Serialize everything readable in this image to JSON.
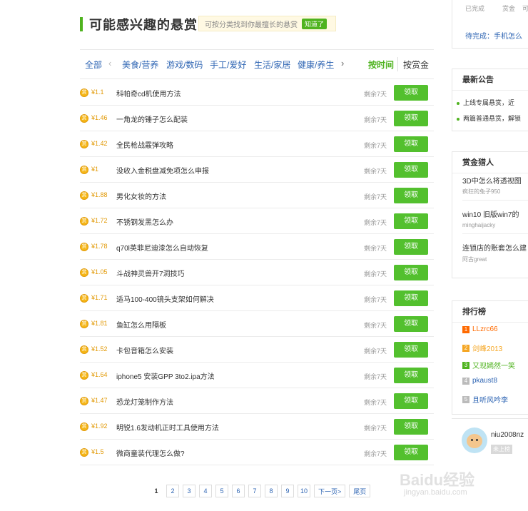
{
  "header": {
    "title": "可能感兴趣的悬赏",
    "tip": "可按分类找到你最擅长的悬赏",
    "tip_button": "知道了"
  },
  "filter": {
    "categories": [
      "全部",
      "美食/营养",
      "游戏/数码",
      "手工/爱好",
      "生活/家居",
      "健康/养生"
    ],
    "prev_arrow": "‹",
    "next_arrow": "›",
    "sort_time": "按时间",
    "sort_reward": "按赏金"
  },
  "questions": [
    {
      "amount": "¥1.1",
      "text": "科帕奇cd机使用方法",
      "remain": "剩余7天",
      "action": "领取"
    },
    {
      "amount": "¥1.46",
      "text": "一角龙的锤子怎么配装",
      "remain": "剩余7天",
      "action": "领取"
    },
    {
      "amount": "¥1.42",
      "text": "全民枪战霰弹攻略",
      "remain": "剩余7天",
      "action": "领取"
    },
    {
      "amount": "¥1",
      "text": "没收入金税盘减免项怎么申报",
      "remain": "剩余7天",
      "action": "领取"
    },
    {
      "amount": "¥1.88",
      "text": "男化女妆的方法",
      "remain": "剩余7天",
      "action": "领取"
    },
    {
      "amount": "¥1.72",
      "text": "不锈钢发黑怎么办",
      "remain": "剩余7天",
      "action": "领取"
    },
    {
      "amount": "¥1.78",
      "text": "q70l英菲尼迪漆怎么自动恢复",
      "remain": "剩余7天",
      "action": "领取"
    },
    {
      "amount": "¥1.05",
      "text": "斗战神灵兽开7洞技巧",
      "remain": "剩余7天",
      "action": "领取"
    },
    {
      "amount": "¥1.71",
      "text": "适马100-400镜头支架如何解决",
      "remain": "剩余7天",
      "action": "领取"
    },
    {
      "amount": "¥1.81",
      "text": "鱼缸怎么用隔板",
      "remain": "剩余7天",
      "action": "领取"
    },
    {
      "amount": "¥1.52",
      "text": "卡包音箱怎么安装",
      "remain": "剩余7天",
      "action": "领取"
    },
    {
      "amount": "¥1.64",
      "text": "iphone5 安装GPP 3to2.ipa方法",
      "remain": "剩余7天",
      "action": "领取"
    },
    {
      "amount": "¥1.47",
      "text": "恐龙灯笼制作方法",
      "remain": "剩余7天",
      "action": "领取"
    },
    {
      "amount": "¥1.92",
      "text": "明锐1.6发动机正时工具使用方法",
      "remain": "剩余7天",
      "action": "领取"
    },
    {
      "amount": "¥1.5",
      "text": "微商童装代理怎么做?",
      "remain": "剩余7天",
      "action": "领取"
    }
  ],
  "coin_glyph": "赏",
  "pager": {
    "current": "1",
    "pages": [
      "2",
      "3",
      "4",
      "5",
      "6",
      "7",
      "8",
      "9",
      "10"
    ],
    "next": "下一页>",
    "last": "尾页"
  },
  "sidebar": {
    "status_tabs": [
      "已完成",
      "赏金",
      "可"
    ],
    "pending": "待完成：手机怎么",
    "notice_title": "最新公告",
    "notices": [
      "上线专属悬赏，近",
      "两篇普通悬赏，解锁"
    ],
    "hunters_title": "赏金猎人",
    "hunters": [
      {
        "question": "3D中怎么将透视图",
        "user": "疯狂的兔子950"
      },
      {
        "question": "win10 旧版win7的",
        "user": "minghaijacky"
      },
      {
        "question": "连锁店的账套怎么建",
        "user": "阿古great"
      }
    ],
    "rank_title": "排行榜",
    "ranks": [
      {
        "n": "1",
        "name": "LLzrc66",
        "color": "#ff6a00"
      },
      {
        "n": "2",
        "name": "剑峰2013",
        "color": "#f5a623"
      },
      {
        "n": "3",
        "name": "又现嫣然一笑",
        "color": "#4fb31f"
      },
      {
        "n": "4",
        "name": "pkaust8",
        "color": "#bbbbbb"
      },
      {
        "n": "5",
        "name": "且听风吟李",
        "color": "#bbbbbb"
      }
    ],
    "profile_name": "niu2008nz",
    "profile_badge": "未上榜"
  },
  "watermark": {
    "main": "Baidu经验",
    "sub": "jingyan.baidu.com"
  }
}
